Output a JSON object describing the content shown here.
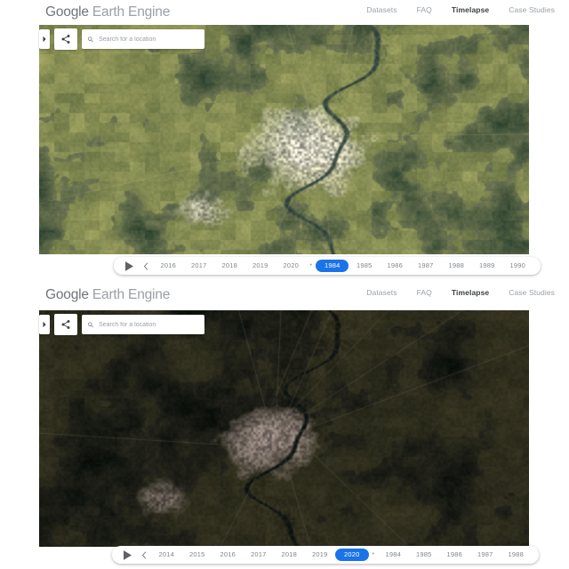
{
  "header": {
    "logo_primary": "Google",
    "logo_secondary": " Earth Engine",
    "nav": [
      {
        "label": "Datasets",
        "active": false
      },
      {
        "label": "FAQ",
        "active": false
      },
      {
        "label": "Timelapse",
        "active": true
      },
      {
        "label": "Case Studies",
        "active": false
      }
    ]
  },
  "controls": {
    "collapse_icon": "chevron-right-icon",
    "share_icon": "share-icon",
    "search_icon": "search-icon",
    "search_placeholder": "Search for a location",
    "search_value": ""
  },
  "colors": {
    "accent_blue": "#1a73e8",
    "nav_inactive": "#9aa0a6",
    "nav_active": "#3c4043",
    "logo_grey": "#70757a",
    "panel_bg": "#ffffff"
  },
  "panels": [
    {
      "id": "panel-1984",
      "name": "timelapse-panel-top",
      "timeline": {
        "play_icon": "play-icon",
        "prev_icon": "chevron-left-icon",
        "separator": "•",
        "selected_year": "1984",
        "years_before": [
          "2016",
          "2017",
          "2018",
          "2019",
          "2020"
        ],
        "years_after": [
          "1985",
          "1986",
          "1987",
          "1988",
          "1989",
          "1990"
        ]
      },
      "imagery": {
        "description": "1984 Landsat composite — bright olive farmland, dark green forest, grey urban core, meandering river",
        "seed": 1984,
        "base_color": "#6d7551",
        "forest_color": "#2e4430",
        "urban_color": "#b9b7a8",
        "water_color": "#3a4a42",
        "brightness": 1.0
      }
    },
    {
      "id": "panel-2020",
      "name": "timelapse-panel-bottom",
      "timeline": {
        "play_icon": "play-icon",
        "prev_icon": "chevron-left-icon",
        "separator": "•",
        "selected_year": "2020",
        "years_before": [
          "2014",
          "2015",
          "2016",
          "2017",
          "2018",
          "2019"
        ],
        "years_after": [
          "1984",
          "1985",
          "1986",
          "1987",
          "1988"
        ]
      },
      "imagery": {
        "description": "2020 Landsat composite — much darker vegetation, expanded pinkish-white urban sprawl, dark river",
        "seed": 2020,
        "base_color": "#3a3a2c",
        "forest_color": "#131a12",
        "urban_color": "#c8b4ab",
        "water_color": "#1d2620",
        "brightness": 0.62
      }
    }
  ]
}
